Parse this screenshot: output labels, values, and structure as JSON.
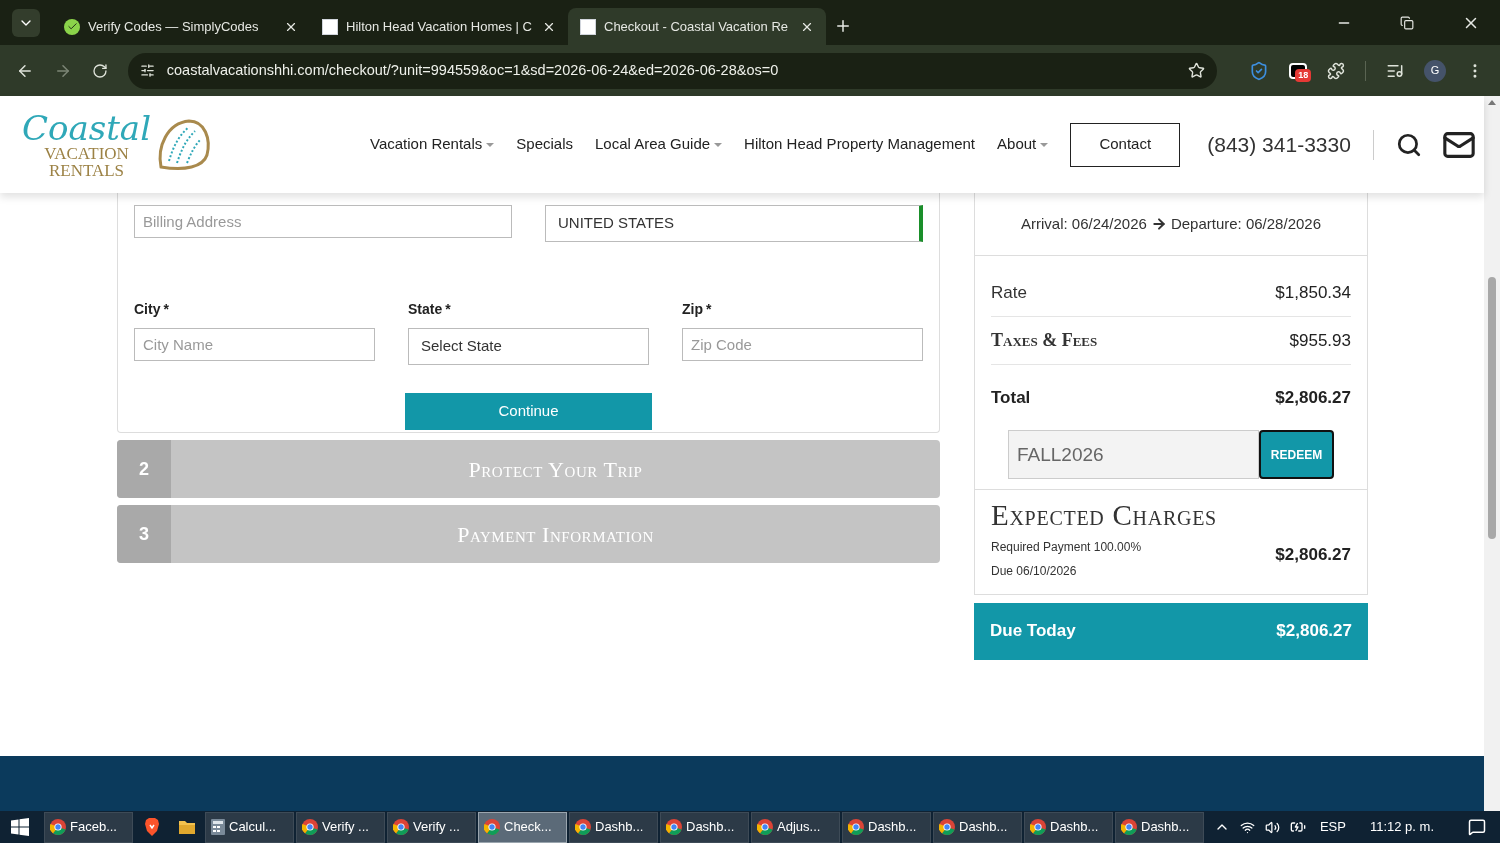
{
  "browser": {
    "tabs": [
      {
        "title": "Verify Codes — SimplyCodes",
        "selected": false,
        "kind": "check"
      },
      {
        "title": "Hilton Head Vacation Homes | C",
        "selected": false,
        "kind": "site"
      },
      {
        "title": "Checkout - Coastal Vacation Re",
        "selected": true,
        "kind": "site"
      }
    ],
    "address": "coastalvacationshhi.com/checkout/?unit=994559&oc=1&sd=2026-06-24&ed=2026-06-28&os=0",
    "badge": "18",
    "avatar": "G"
  },
  "header": {
    "logo": {
      "script": "Coastal",
      "line1": "VACATION",
      "line2": "RENTALS"
    },
    "nav": [
      {
        "label": "Vacation Rentals",
        "dropdown": true
      },
      {
        "label": "Specials",
        "dropdown": false
      },
      {
        "label": "Local Area Guide",
        "dropdown": true
      },
      {
        "label": "Hilton Head Property Management",
        "dropdown": false
      },
      {
        "label": "About",
        "dropdown": true
      }
    ],
    "contact": "Contact",
    "phone": "(843) 341-3330"
  },
  "form": {
    "billing_placeholder": "Billing Address",
    "country": "UNITED STATES",
    "fields": [
      {
        "label": "City",
        "marker": "*",
        "kind": "input",
        "placeholder": "City Name"
      },
      {
        "label": "State",
        "marker": "*",
        "kind": "select",
        "value": "Select State"
      },
      {
        "label": "Zip",
        "marker": "*",
        "kind": "input",
        "placeholder": "Zip Code"
      }
    ],
    "continue": "Continue"
  },
  "steps": [
    {
      "number": "2",
      "title": "Protect Your Trip"
    },
    {
      "number": "3",
      "title": "Payment Information"
    }
  ],
  "summary": {
    "arrival": "Arrival: 06/24/2026",
    "departure": "Departure: 06/28/2026",
    "rows": [
      {
        "label": "Rate",
        "value": "$1,850.34",
        "kind": "plain"
      },
      {
        "label": "Taxes & Fees",
        "value": "$955.93",
        "kind": "fancy"
      },
      {
        "label": "Total",
        "value": "$2,806.27",
        "kind": "total"
      }
    ],
    "coupon": "FALL2026",
    "redeem": "REDEEM",
    "expected": {
      "title": "Expected Charges",
      "required": "Required Payment 100.00%",
      "due": "Due 06/10/2026",
      "amount": "$2,806.27"
    },
    "due_today": {
      "label": "Due Today",
      "amount": "$2,806.27"
    }
  },
  "taskbar": {
    "items": [
      {
        "label": "Faceb...",
        "kind": "chrome",
        "active": false
      },
      {
        "kind": "brave",
        "active": false
      },
      {
        "kind": "folder",
        "active": false
      },
      {
        "label": "Calcul...",
        "kind": "calc",
        "active": false
      },
      {
        "label": "Verify ...",
        "kind": "chrome",
        "active": false
      },
      {
        "label": "Verify ...",
        "kind": "chrome",
        "active": false
      },
      {
        "label": "Check...",
        "kind": "chrome",
        "active": true
      },
      {
        "label": "Dashb...",
        "kind": "chrome",
        "active": false
      },
      {
        "label": "Dashb...",
        "kind": "chrome",
        "active": false
      },
      {
        "label": "Adjus...",
        "kind": "chrome",
        "active": false
      },
      {
        "label": "Dashb...",
        "kind": "chrome",
        "active": false
      },
      {
        "label": "Dashb...",
        "kind": "chrome",
        "active": false
      },
      {
        "label": "Dashb...",
        "kind": "chrome",
        "active": false
      },
      {
        "label": "Dashb...",
        "kind": "chrome",
        "active": false
      }
    ],
    "lang": "ESP",
    "time": "11:12 p. m."
  }
}
